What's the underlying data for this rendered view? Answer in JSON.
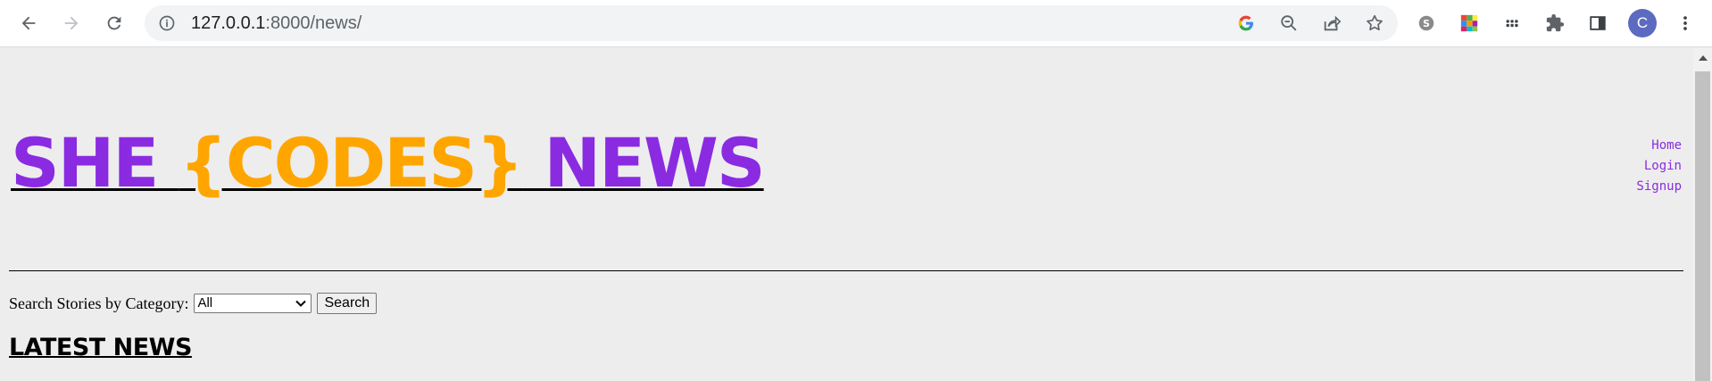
{
  "browser": {
    "url_host": "127.0.0.1",
    "url_path": ":8000/news/",
    "profile_initial": "C"
  },
  "site": {
    "title_part1": "SHE ",
    "title_part2": "{CODES}",
    "title_part3": " NEWS",
    "colors": {
      "purple": "#8a2be2",
      "orange": "#ffa500"
    }
  },
  "nav": {
    "home": "Home",
    "login": "Login",
    "signup": "Signup"
  },
  "search": {
    "label": "Search Stories by Category:",
    "selected": "All",
    "button": "Search"
  },
  "section": {
    "heading": "LATEST NEWS"
  }
}
